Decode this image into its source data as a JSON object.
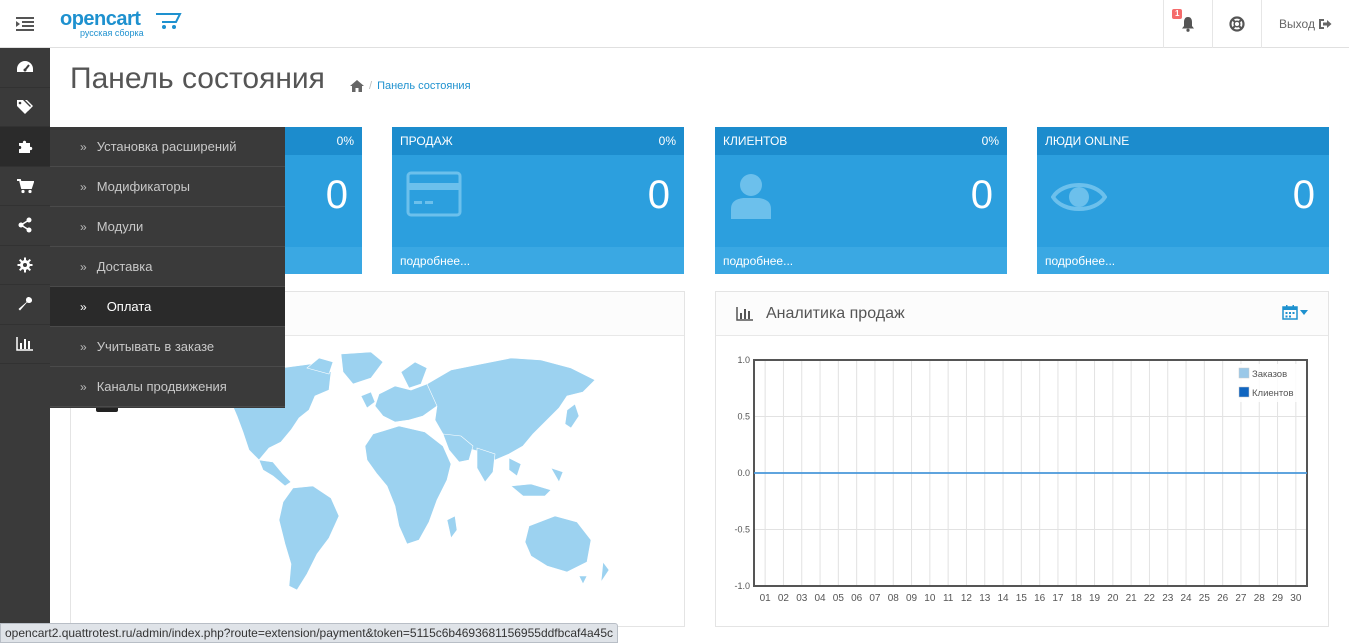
{
  "header": {
    "logo_text": "opencart",
    "logo_subtext": "русская сборка",
    "notification_count": "1",
    "logout_label": "Выход"
  },
  "sidebar": {
    "icons": [
      "dashboard-icon",
      "tags-icon",
      "puzzle-icon",
      "cart-icon",
      "share-icon",
      "gear-icon",
      "wrench-icon",
      "bar-chart-icon"
    ]
  },
  "flyout": {
    "items": [
      {
        "label": "Установка расширений"
      },
      {
        "label": "Модификаторы"
      },
      {
        "label": "Модули"
      },
      {
        "label": "Доставка"
      },
      {
        "label": "Оплата"
      },
      {
        "label": "Учитывать в заказе"
      },
      {
        "label": "Каналы продвижения"
      }
    ]
  },
  "page": {
    "title": "Панель состояния",
    "breadcrumb": "Панель состояния"
  },
  "tiles": [
    {
      "title": "",
      "percent": "0%",
      "value": "0",
      "footer": ""
    },
    {
      "title": "ПРОДАЖ",
      "percent": "0%",
      "value": "0",
      "footer": "подробнее..."
    },
    {
      "title": "КЛИЕНТОВ",
      "percent": "0%",
      "value": "0",
      "footer": "подробнее..."
    },
    {
      "title": "ЛЮДИ ONLINE",
      "percent": "",
      "value": "0",
      "footer": "подробнее..."
    }
  ],
  "analytics": {
    "title": "Аналитика продаж"
  },
  "chart_data": {
    "type": "line",
    "title": "Аналитика продаж",
    "categories": [
      "01",
      "02",
      "03",
      "04",
      "05",
      "06",
      "07",
      "08",
      "09",
      "10",
      "11",
      "12",
      "13",
      "14",
      "15",
      "16",
      "17",
      "18",
      "19",
      "20",
      "21",
      "22",
      "23",
      "24",
      "25",
      "26",
      "27",
      "28",
      "29",
      "30"
    ],
    "y_ticks": [
      "1.0",
      "0.5",
      "0.0",
      "-0.5",
      "-1.0"
    ],
    "ylim": [
      -1.0,
      1.0
    ],
    "grid": true,
    "legend_position": "top-right",
    "series": [
      {
        "name": "Заказов",
        "color": "#9ac8e8",
        "values": [
          0,
          0,
          0,
          0,
          0,
          0,
          0,
          0,
          0,
          0,
          0,
          0,
          0,
          0,
          0,
          0,
          0,
          0,
          0,
          0,
          0,
          0,
          0,
          0,
          0,
          0,
          0,
          0,
          0,
          0
        ]
      },
      {
        "name": "Клиентов",
        "color": "#1065c0",
        "values": [
          0,
          0,
          0,
          0,
          0,
          0,
          0,
          0,
          0,
          0,
          0,
          0,
          0,
          0,
          0,
          0,
          0,
          0,
          0,
          0,
          0,
          0,
          0,
          0,
          0,
          0,
          0,
          0,
          0,
          0
        ]
      }
    ]
  },
  "status_bar": {
    "url": "opencart2.quattrotest.ru/admin/index.php?route=extension/payment&token=5115c6b4693681156955ddfbcaf4a45c"
  },
  "colors": {
    "tile_bg": "#2c9fde",
    "tile_head": "#1c8ccd",
    "sidebar_bg": "#3a3a3a",
    "accent": "#1e91cf",
    "map_fill": "#9cd2f0"
  }
}
